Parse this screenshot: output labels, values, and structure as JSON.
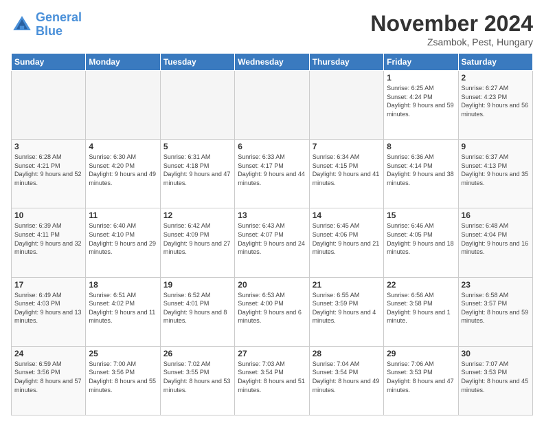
{
  "logo": {
    "line1": "General",
    "line2": "Blue"
  },
  "header": {
    "month": "November 2024",
    "location": "Zsambok, Pest, Hungary"
  },
  "weekdays": [
    "Sunday",
    "Monday",
    "Tuesday",
    "Wednesday",
    "Thursday",
    "Friday",
    "Saturday"
  ],
  "weeks": [
    [
      {
        "day": "",
        "sunrise": "",
        "sunset": "",
        "daylight": ""
      },
      {
        "day": "",
        "sunrise": "",
        "sunset": "",
        "daylight": ""
      },
      {
        "day": "",
        "sunrise": "",
        "sunset": "",
        "daylight": ""
      },
      {
        "day": "",
        "sunrise": "",
        "sunset": "",
        "daylight": ""
      },
      {
        "day": "",
        "sunrise": "",
        "sunset": "",
        "daylight": ""
      },
      {
        "day": "1",
        "sunrise": "Sunrise: 6:25 AM",
        "sunset": "Sunset: 4:24 PM",
        "daylight": "Daylight: 9 hours and 59 minutes."
      },
      {
        "day": "2",
        "sunrise": "Sunrise: 6:27 AM",
        "sunset": "Sunset: 4:23 PM",
        "daylight": "Daylight: 9 hours and 56 minutes."
      }
    ],
    [
      {
        "day": "3",
        "sunrise": "Sunrise: 6:28 AM",
        "sunset": "Sunset: 4:21 PM",
        "daylight": "Daylight: 9 hours and 52 minutes."
      },
      {
        "day": "4",
        "sunrise": "Sunrise: 6:30 AM",
        "sunset": "Sunset: 4:20 PM",
        "daylight": "Daylight: 9 hours and 49 minutes."
      },
      {
        "day": "5",
        "sunrise": "Sunrise: 6:31 AM",
        "sunset": "Sunset: 4:18 PM",
        "daylight": "Daylight: 9 hours and 47 minutes."
      },
      {
        "day": "6",
        "sunrise": "Sunrise: 6:33 AM",
        "sunset": "Sunset: 4:17 PM",
        "daylight": "Daylight: 9 hours and 44 minutes."
      },
      {
        "day": "7",
        "sunrise": "Sunrise: 6:34 AM",
        "sunset": "Sunset: 4:15 PM",
        "daylight": "Daylight: 9 hours and 41 minutes."
      },
      {
        "day": "8",
        "sunrise": "Sunrise: 6:36 AM",
        "sunset": "Sunset: 4:14 PM",
        "daylight": "Daylight: 9 hours and 38 minutes."
      },
      {
        "day": "9",
        "sunrise": "Sunrise: 6:37 AM",
        "sunset": "Sunset: 4:13 PM",
        "daylight": "Daylight: 9 hours and 35 minutes."
      }
    ],
    [
      {
        "day": "10",
        "sunrise": "Sunrise: 6:39 AM",
        "sunset": "Sunset: 4:11 PM",
        "daylight": "Daylight: 9 hours and 32 minutes."
      },
      {
        "day": "11",
        "sunrise": "Sunrise: 6:40 AM",
        "sunset": "Sunset: 4:10 PM",
        "daylight": "Daylight: 9 hours and 29 minutes."
      },
      {
        "day": "12",
        "sunrise": "Sunrise: 6:42 AM",
        "sunset": "Sunset: 4:09 PM",
        "daylight": "Daylight: 9 hours and 27 minutes."
      },
      {
        "day": "13",
        "sunrise": "Sunrise: 6:43 AM",
        "sunset": "Sunset: 4:07 PM",
        "daylight": "Daylight: 9 hours and 24 minutes."
      },
      {
        "day": "14",
        "sunrise": "Sunrise: 6:45 AM",
        "sunset": "Sunset: 4:06 PM",
        "daylight": "Daylight: 9 hours and 21 minutes."
      },
      {
        "day": "15",
        "sunrise": "Sunrise: 6:46 AM",
        "sunset": "Sunset: 4:05 PM",
        "daylight": "Daylight: 9 hours and 18 minutes."
      },
      {
        "day": "16",
        "sunrise": "Sunrise: 6:48 AM",
        "sunset": "Sunset: 4:04 PM",
        "daylight": "Daylight: 9 hours and 16 minutes."
      }
    ],
    [
      {
        "day": "17",
        "sunrise": "Sunrise: 6:49 AM",
        "sunset": "Sunset: 4:03 PM",
        "daylight": "Daylight: 9 hours and 13 minutes."
      },
      {
        "day": "18",
        "sunrise": "Sunrise: 6:51 AM",
        "sunset": "Sunset: 4:02 PM",
        "daylight": "Daylight: 9 hours and 11 minutes."
      },
      {
        "day": "19",
        "sunrise": "Sunrise: 6:52 AM",
        "sunset": "Sunset: 4:01 PM",
        "daylight": "Daylight: 9 hours and 8 minutes."
      },
      {
        "day": "20",
        "sunrise": "Sunrise: 6:53 AM",
        "sunset": "Sunset: 4:00 PM",
        "daylight": "Daylight: 9 hours and 6 minutes."
      },
      {
        "day": "21",
        "sunrise": "Sunrise: 6:55 AM",
        "sunset": "Sunset: 3:59 PM",
        "daylight": "Daylight: 9 hours and 4 minutes."
      },
      {
        "day": "22",
        "sunrise": "Sunrise: 6:56 AM",
        "sunset": "Sunset: 3:58 PM",
        "daylight": "Daylight: 9 hours and 1 minute."
      },
      {
        "day": "23",
        "sunrise": "Sunrise: 6:58 AM",
        "sunset": "Sunset: 3:57 PM",
        "daylight": "Daylight: 8 hours and 59 minutes."
      }
    ],
    [
      {
        "day": "24",
        "sunrise": "Sunrise: 6:59 AM",
        "sunset": "Sunset: 3:56 PM",
        "daylight": "Daylight: 8 hours and 57 minutes."
      },
      {
        "day": "25",
        "sunrise": "Sunrise: 7:00 AM",
        "sunset": "Sunset: 3:56 PM",
        "daylight": "Daylight: 8 hours and 55 minutes."
      },
      {
        "day": "26",
        "sunrise": "Sunrise: 7:02 AM",
        "sunset": "Sunset: 3:55 PM",
        "daylight": "Daylight: 8 hours and 53 minutes."
      },
      {
        "day": "27",
        "sunrise": "Sunrise: 7:03 AM",
        "sunset": "Sunset: 3:54 PM",
        "daylight": "Daylight: 8 hours and 51 minutes."
      },
      {
        "day": "28",
        "sunrise": "Sunrise: 7:04 AM",
        "sunset": "Sunset: 3:54 PM",
        "daylight": "Daylight: 8 hours and 49 minutes."
      },
      {
        "day": "29",
        "sunrise": "Sunrise: 7:06 AM",
        "sunset": "Sunset: 3:53 PM",
        "daylight": "Daylight: 8 hours and 47 minutes."
      },
      {
        "day": "30",
        "sunrise": "Sunrise: 7:07 AM",
        "sunset": "Sunset: 3:53 PM",
        "daylight": "Daylight: 8 hours and 45 minutes."
      }
    ]
  ]
}
